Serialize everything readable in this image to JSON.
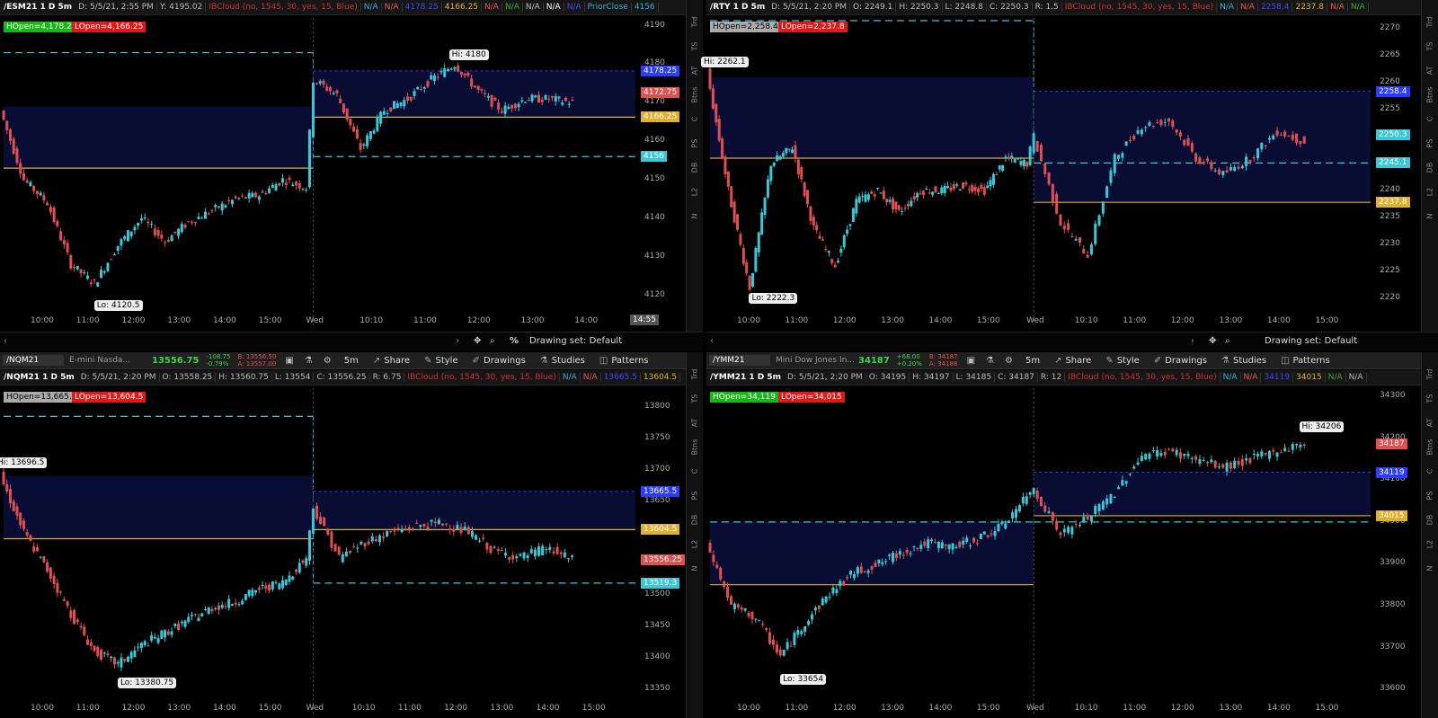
{
  "panels": [
    {
      "id": "tl",
      "symbol_field": "",
      "toolbar": null,
      "header": {
        "symbol": "/ESM21 1 D 5m",
        "fields": [
          "D: 5/5/21, 2:55 PM",
          "Y: 4195.02"
        ],
        "studies": [
          {
            "t": "IBCloud (no, 1545, 30, yes, 15, Blue)",
            "c": "#c33"
          },
          {
            "t": "N/A",
            "c": "#3ad"
          },
          {
            "t": "N/A",
            "c": "#e55"
          },
          {
            "t": "4178.25",
            "c": "#44f"
          },
          {
            "t": "4166.25",
            "c": "#e0b030"
          },
          {
            "t": "N/A",
            "c": "#e55"
          },
          {
            "t": "N/A",
            "c": "#3a3"
          },
          {
            "t": "N/A",
            "c": "#bbb"
          },
          {
            "t": "N/A",
            "c": "#fff"
          },
          {
            "t": "N/A",
            "c": "#44f"
          },
          {
            "t": "PriorClose",
            "c": "#3ad"
          },
          {
            "t": "4156",
            "c": "#3ad"
          }
        ]
      },
      "badges": [
        {
          "t": "HOpen=4,178.25",
          "c": "#18b718"
        },
        {
          "t": "LOpen=4,166.25",
          "c": "#e01818"
        }
      ],
      "price_axis": [
        "4190",
        "4180",
        "4170",
        "4160",
        "4150",
        "4140",
        "4130",
        "4120"
      ],
      "time_axis": [
        "10:00",
        "11:00",
        "12:00",
        "13:00",
        "14:00",
        "15:00",
        "Wed",
        "10:10",
        "11:00",
        "12:00",
        "13:00",
        "14:00"
      ],
      "price_tags": [
        {
          "t": "4178.25",
          "c": "#2a3cff"
        },
        {
          "t": "4172.75",
          "c": "#e05050"
        },
        {
          "t": "4166.25",
          "c": "#e0b030"
        },
        {
          "t": "4156",
          "c": "#3ac8d8"
        }
      ],
      "hi_label": "Hi: 4180",
      "lo_label": "Lo: 4120.5",
      "time_tag": "14:55",
      "footer": {
        "drawing_set": "Drawing set: Default",
        "percent": "%"
      },
      "colors": {
        "cloud": "#0a0d33",
        "hline": "#e0b030",
        "dashed": "#3ac8d8",
        "up": "#3ac8d8",
        "down": "#e05050"
      },
      "chart_data": {
        "type": "candlestick",
        "ylim": [
          4115,
          4192
        ],
        "series": [
          {
            "name": "close",
            "x": [
              "09:30",
              "10:00",
              "10:30",
              "11:00",
              "11:30",
              "12:00",
              "12:30",
              "13:00",
              "13:30",
              "14:00",
              "14:30",
              "15:00",
              "15:30",
              "16:10",
              "Wed 09:30",
              "Wed 09:45",
              "Wed 10:10",
              "Wed 10:30",
              "Wed 11:00",
              "Wed 11:30",
              "Wed 11:55",
              "Wed 12:30",
              "Wed 13:00",
              "Wed 13:30",
              "Wed 14:00",
              "Wed 14:20"
            ],
            "values": [
              4168,
              4150,
              4144,
              4128,
              4123,
              4133,
              4140,
              4134,
              4139,
              4142,
              4145,
              4146,
              4150,
              4148,
              4176,
              4172,
              4158,
              4168,
              4171,
              4176,
              4180,
              4173,
              4168,
              4171,
              4171,
              4170
            ]
          }
        ],
        "levels": {
          "hopen": 4178.25,
          "lopen": 4166.25,
          "prior_close": 4156,
          "prev_hline": 4153,
          "prev_dashed": 4183,
          "prev_cloud": [
            4153,
            4169
          ]
        },
        "hi": 4180,
        "lo": 4120.5
      }
    },
    {
      "id": "tr",
      "toolbar": null,
      "header": {
        "symbol": "/RTY 1 D 5m",
        "fields": [
          "D: 5/5/21, 2:20 PM",
          "O: 2249.1",
          "H: 2250.3",
          "L: 2248.8",
          "C: 2250.3",
          "R: 1.5"
        ],
        "studies": [
          {
            "t": "IBCloud (no, 1545, 30, yes, 15, Blue)",
            "c": "#c33"
          },
          {
            "t": "N/A",
            "c": "#3ad"
          },
          {
            "t": "N/A",
            "c": "#e55"
          },
          {
            "t": "2258.4",
            "c": "#44f"
          },
          {
            "t": "2237.8",
            "c": "#e0b030"
          },
          {
            "t": "N/A",
            "c": "#e55"
          },
          {
            "t": "N/A",
            "c": "#3a3"
          }
        ]
      },
      "badges": [
        {
          "t": "HOpen=2,258.4",
          "c": "#aaa"
        },
        {
          "t": "LOpen=2,237.8",
          "c": "#e01818"
        }
      ],
      "price_axis": [
        "2270",
        "2265",
        "2260",
        "2255",
        "2250",
        "2245",
        "2240",
        "2235",
        "2230",
        "2225",
        "2220"
      ],
      "time_axis": [
        "10:00",
        "11:00",
        "12:00",
        "13:00",
        "14:00",
        "15:00",
        "Wed",
        "10:10",
        "11:00",
        "12:00",
        "13:00",
        "14:00",
        "15:00"
      ],
      "price_tags": [
        {
          "t": "2258.4",
          "c": "#2a3cff"
        },
        {
          "t": "2250.3",
          "c": "#3ac8d8"
        },
        {
          "t": "2245.1",
          "c": "#3ac8d8"
        },
        {
          "t": "2237.8",
          "c": "#e0b030"
        }
      ],
      "hi_label": "Hi: 2262.1",
      "lo_label": "Lo: 2222.3",
      "time_tag": "",
      "footer": {
        "drawing_set": "Drawing set: Default",
        "percent": ""
      },
      "colors": {
        "cloud": "#0a0d33",
        "hline": "#e0b030",
        "dashed": "#3ac8d8",
        "up": "#3ac8d8",
        "down": "#e05050"
      },
      "chart_data": {
        "type": "candlestick",
        "ylim": [
          2217,
          2272
        ],
        "series": [
          {
            "name": "close",
            "x": [
              "09:30",
              "09:45",
              "10:00",
              "10:15",
              "10:30",
              "11:00",
              "11:30",
              "12:00",
              "12:30",
              "13:00",
              "13:30",
              "14:00",
              "14:30",
              "15:00",
              "15:30",
              "16:10",
              "Wed 09:30",
              "Wed 10:00",
              "Wed 10:30",
              "Wed 11:00",
              "Wed 11:30",
              "Wed 12:00",
              "Wed 12:30",
              "Wed 13:00",
              "Wed 13:30",
              "Wed 14:00",
              "Wed 14:20"
            ],
            "values": [
              2262,
              2240,
              2222,
              2245,
              2248,
              2233,
              2226,
              2238,
              2240,
              2236,
              2240,
              2240,
              2241,
              2240,
              2246,
              2245,
              2250,
              2234,
              2228,
              2246,
              2252,
              2253,
              2246,
              2243,
              2246,
              2251,
              2249
            ]
          }
        ],
        "levels": {
          "hopen": 2258.4,
          "lopen": 2237.8,
          "prior_close": 2245.1,
          "prev_hline": 2246,
          "prev_dashed": 2271.5,
          "prev_cloud": [
            2246,
            2261
          ]
        },
        "hi": 2262.1,
        "lo": 2222.3
      }
    },
    {
      "id": "bl",
      "toolbar": {
        "symbol": "/NQM21",
        "desc": "E-mini Nasda...",
        "last": "13556.75",
        "chg": [
          "-108.75",
          "-0.79%"
        ],
        "bid_ask": [
          "B: 13556.50",
          "A: 13557.00"
        ],
        "interval": "5m",
        "buttons": [
          "Share",
          "Style",
          "Drawings",
          "Studies",
          "Patterns"
        ]
      },
      "header": {
        "symbol": "/NQM21 1 D 5m",
        "fields": [
          "D: 5/5/21, 2:20 PM",
          "O: 13558.25",
          "H: 13560.75",
          "L: 13554",
          "C: 13556.25",
          "R: 6.75"
        ],
        "studies": [
          {
            "t": "IBCloud (no, 1545, 30, yes, 15, Blue)",
            "c": "#c33"
          },
          {
            "t": "N/A",
            "c": "#3ad"
          },
          {
            "t": "N/A",
            "c": "#e55"
          },
          {
            "t": "13665.5",
            "c": "#44f"
          },
          {
            "t": "13604.5",
            "c": "#e0b030"
          }
        ]
      },
      "badges": [
        {
          "t": "HOpen=13,665.5",
          "c": "#aaa"
        },
        {
          "t": "LOpen=13,604.5",
          "c": "#e01818"
        }
      ],
      "price_axis": [
        "13800",
        "13750",
        "13700",
        "13650",
        "13600",
        "13550",
        "13500",
        "13450",
        "13400",
        "13350"
      ],
      "time_axis": [
        "10:00",
        "11:00",
        "12:00",
        "13:00",
        "14:00",
        "15:00",
        "Wed",
        "10:10",
        "11:00",
        "12:00",
        "13:00",
        "14:00",
        "15:00"
      ],
      "price_tags": [
        {
          "t": "13665.5",
          "c": "#2a3cff"
        },
        {
          "t": "13604.5",
          "c": "#e0b030"
        },
        {
          "t": "13556.25",
          "c": "#e05050"
        },
        {
          "t": "13519.3",
          "c": "#3ac8d8"
        }
      ],
      "hi_label": "Hi: 13696.5",
      "lo_label": "Lo: 13380.75",
      "time_tag": "",
      "footer": null,
      "colors": {
        "cloud": "#0a0d33",
        "hline": "#e0b030",
        "dashed": "#3ac8d8",
        "up": "#3ac8d8",
        "down": "#e05050"
      },
      "chart_data": {
        "type": "candlestick",
        "ylim": [
          13330,
          13830
        ],
        "series": [
          {
            "name": "close",
            "x": [
              "09:30",
              "10:00",
              "10:30",
              "11:00",
              "11:30",
              "12:00",
              "12:30",
              "13:00",
              "13:30",
              "14:00",
              "14:30",
              "15:00",
              "15:30",
              "16:10",
              "Wed 09:30",
              "Wed 10:00",
              "Wed 10:30",
              "Wed 11:00",
              "Wed 11:30",
              "Wed 12:00",
              "Wed 12:30",
              "Wed 13:00",
              "Wed 13:30",
              "Wed 14:00",
              "Wed 14:20"
            ],
            "values": [
              13690,
              13600,
              13540,
              13470,
              13410,
              13390,
              13420,
              13440,
              13460,
              13480,
              13490,
              13510,
              13520,
              13560,
              13640,
              13560,
              13585,
              13600,
              13610,
              13615,
              13600,
              13570,
              13560,
              13575,
              13556
            ]
          }
        ],
        "levels": {
          "hopen": 13665.5,
          "lopen": 13604.5,
          "prior_close": 13519.3,
          "prev_hline": 13590,
          "prev_dashed": 13785,
          "prev_cloud": [
            13590,
            13690
          ]
        },
        "hi": 13696.5,
        "lo": 13380.75
      }
    },
    {
      "id": "br",
      "toolbar": {
        "symbol": "/YMM21",
        "desc": "Mini Dow Jones In...",
        "last": "34187",
        "chg": [
          "+68.00",
          "+0.20%"
        ],
        "bid_ask": [
          "B: 34187",
          "A: 34188"
        ],
        "interval": "5m",
        "buttons": [
          "Share",
          "Style",
          "Drawings",
          "Studies",
          "Patterns"
        ]
      },
      "header": {
        "symbol": "/YMM21 1 D 5m",
        "fields": [
          "D: 5/5/21, 2:20 PM",
          "O: 34195",
          "H: 34197",
          "L: 34185",
          "C: 34187",
          "R: 12"
        ],
        "studies": [
          {
            "t": "IBCloud (no, 1545, 30, yes, 15, Blue)",
            "c": "#c33"
          },
          {
            "t": "N/A",
            "c": "#3ad"
          },
          {
            "t": "N/A",
            "c": "#e55"
          },
          {
            "t": "34119",
            "c": "#44f"
          },
          {
            "t": "34015",
            "c": "#e0b030"
          },
          {
            "t": "N/A",
            "c": "#3a3"
          },
          {
            "t": "N/A",
            "c": "#bbb"
          }
        ]
      },
      "badges": [
        {
          "t": "HOpen=34,119",
          "c": "#18b718"
        },
        {
          "t": "LOpen=34,015",
          "c": "#e01818"
        }
      ],
      "price_axis": [
        "34300",
        "34200",
        "34100",
        "34000",
        "33900",
        "33800",
        "33700",
        "33600"
      ],
      "time_axis": [
        "10:00",
        "11:00",
        "12:00",
        "13:00",
        "14:00",
        "15:00",
        "Wed",
        "10:10",
        "11:00",
        "12:00",
        "13:00",
        "14:00",
        "15:00"
      ],
      "price_tags": [
        {
          "t": "34187",
          "c": "#e05050"
        },
        {
          "t": "34119",
          "c": "#2a3cff"
        },
        {
          "t": "34015",
          "c": "#e0b030"
        }
      ],
      "hi_label": "Hi: 34206",
      "lo_label": "Lo: 33654",
      "time_tag": "",
      "footer": null,
      "colors": {
        "cloud": "#0a0d33",
        "hline": "#e0b030",
        "dashed": "#3ac8d8",
        "up": "#3ac8d8",
        "down": "#e05050"
      },
      "chart_data": {
        "type": "candlestick",
        "ylim": [
          33570,
          34320
        ],
        "series": [
          {
            "name": "close",
            "x": [
              "09:30",
              "10:00",
              "10:30",
              "11:00",
              "11:30",
              "12:00",
              "12:30",
              "13:00",
              "13:30",
              "14:00",
              "14:30",
              "15:00",
              "15:30",
              "16:10",
              "Wed 09:30",
              "Wed 10:00",
              "Wed 10:30",
              "Wed 11:00",
              "Wed 11:30",
              "Wed 12:00",
              "Wed 12:30",
              "Wed 13:00",
              "Wed 13:30",
              "Wed 14:00",
              "Wed 14:20"
            ],
            "values": [
              33950,
              33800,
              33770,
              33680,
              33760,
              33830,
              33880,
              33900,
              33930,
              33950,
              33940,
              33960,
              33990,
              34060,
              34080,
              33970,
              34010,
              34070,
              34160,
              34170,
              34150,
              34130,
              34150,
              34170,
              34187
            ]
          }
        ],
        "levels": {
          "hopen": 34119,
          "lopen": 34015,
          "prior_close": 34000,
          "prev_hline": 33850,
          "prev_dashed": 34000,
          "prev_cloud": [
            33850,
            34000
          ]
        },
        "hi": 34206,
        "lo": 33654
      }
    }
  ],
  "sidebar": [
    "Trd",
    "TS",
    "AT",
    "Btns",
    "C",
    "PS",
    "DB",
    "L2",
    "N"
  ]
}
